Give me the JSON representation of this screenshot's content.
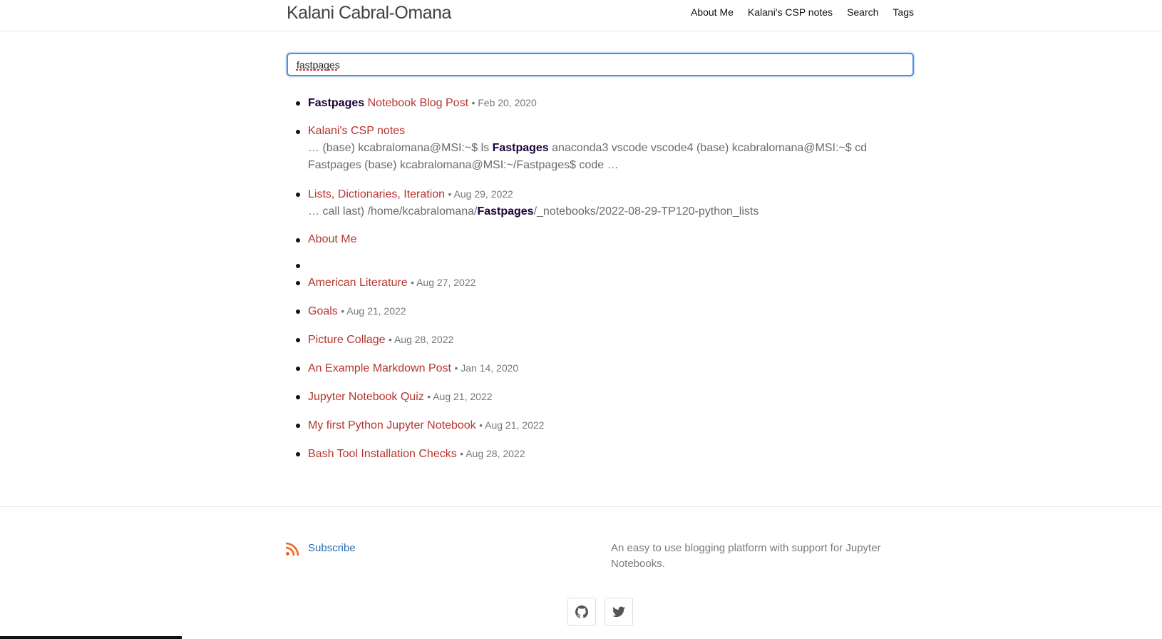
{
  "header": {
    "site_title": "Kalani Cabral-Omana",
    "nav": [
      "About Me",
      "Kalani's CSP notes",
      "Search",
      "Tags"
    ]
  },
  "search": {
    "value": "fastpages"
  },
  "results": [
    {
      "pre_hl": "Fastpages",
      "title": " Notebook Blog Post",
      "date": "• Feb 20, 2020"
    },
    {
      "title": "Kalani's CSP notes",
      "ex1": "… (base) kcabralomana@MSI:~$ ls ",
      "ex_hl": "Fastpages",
      "ex2": " anaconda3 vscode vscode4 (base) kcabralomana@MSI:~$ cd Fastpages (base) kcabralomana@MSI:~/Fastpages$ code …"
    },
    {
      "title": "Lists, Dictionaries, Iteration",
      "date": "• Aug 29, 2022",
      "ex1": "… call last) /home/kcabralomana/",
      "ex_hl": "Fastpages",
      "ex2": "/_notebooks/2022-08-29-TP120-python_lists"
    },
    {
      "title": "About Me"
    },
    {
      "title": ""
    },
    {
      "title": "American Literature",
      "date": "• Aug 27, 2022"
    },
    {
      "title": "Goals",
      "date": "• Aug 21, 2022"
    },
    {
      "title": "Picture Collage",
      "date": "• Aug 28, 2022"
    },
    {
      "title": "An Example Markdown Post",
      "date": "• Jan 14, 2020"
    },
    {
      "title": "Jupyter Notebook Quiz",
      "date": "• Aug 21, 2022"
    },
    {
      "title": "My first Python Jupyter Notebook",
      "date": "• Aug 21, 2022"
    },
    {
      "title": "Bash Tool Installation Checks",
      "date": "• Aug 28, 2022"
    }
  ],
  "footer": {
    "subscribe": "Subscribe",
    "tagline": "An easy to use blogging platform with support for Jupyter Notebooks.",
    "social": [
      "github-icon",
      "twitter-icon"
    ]
  },
  "colors": {
    "link": "#b5352f",
    "accent_blue": "#2a6cb5",
    "rss": "#f26522"
  }
}
